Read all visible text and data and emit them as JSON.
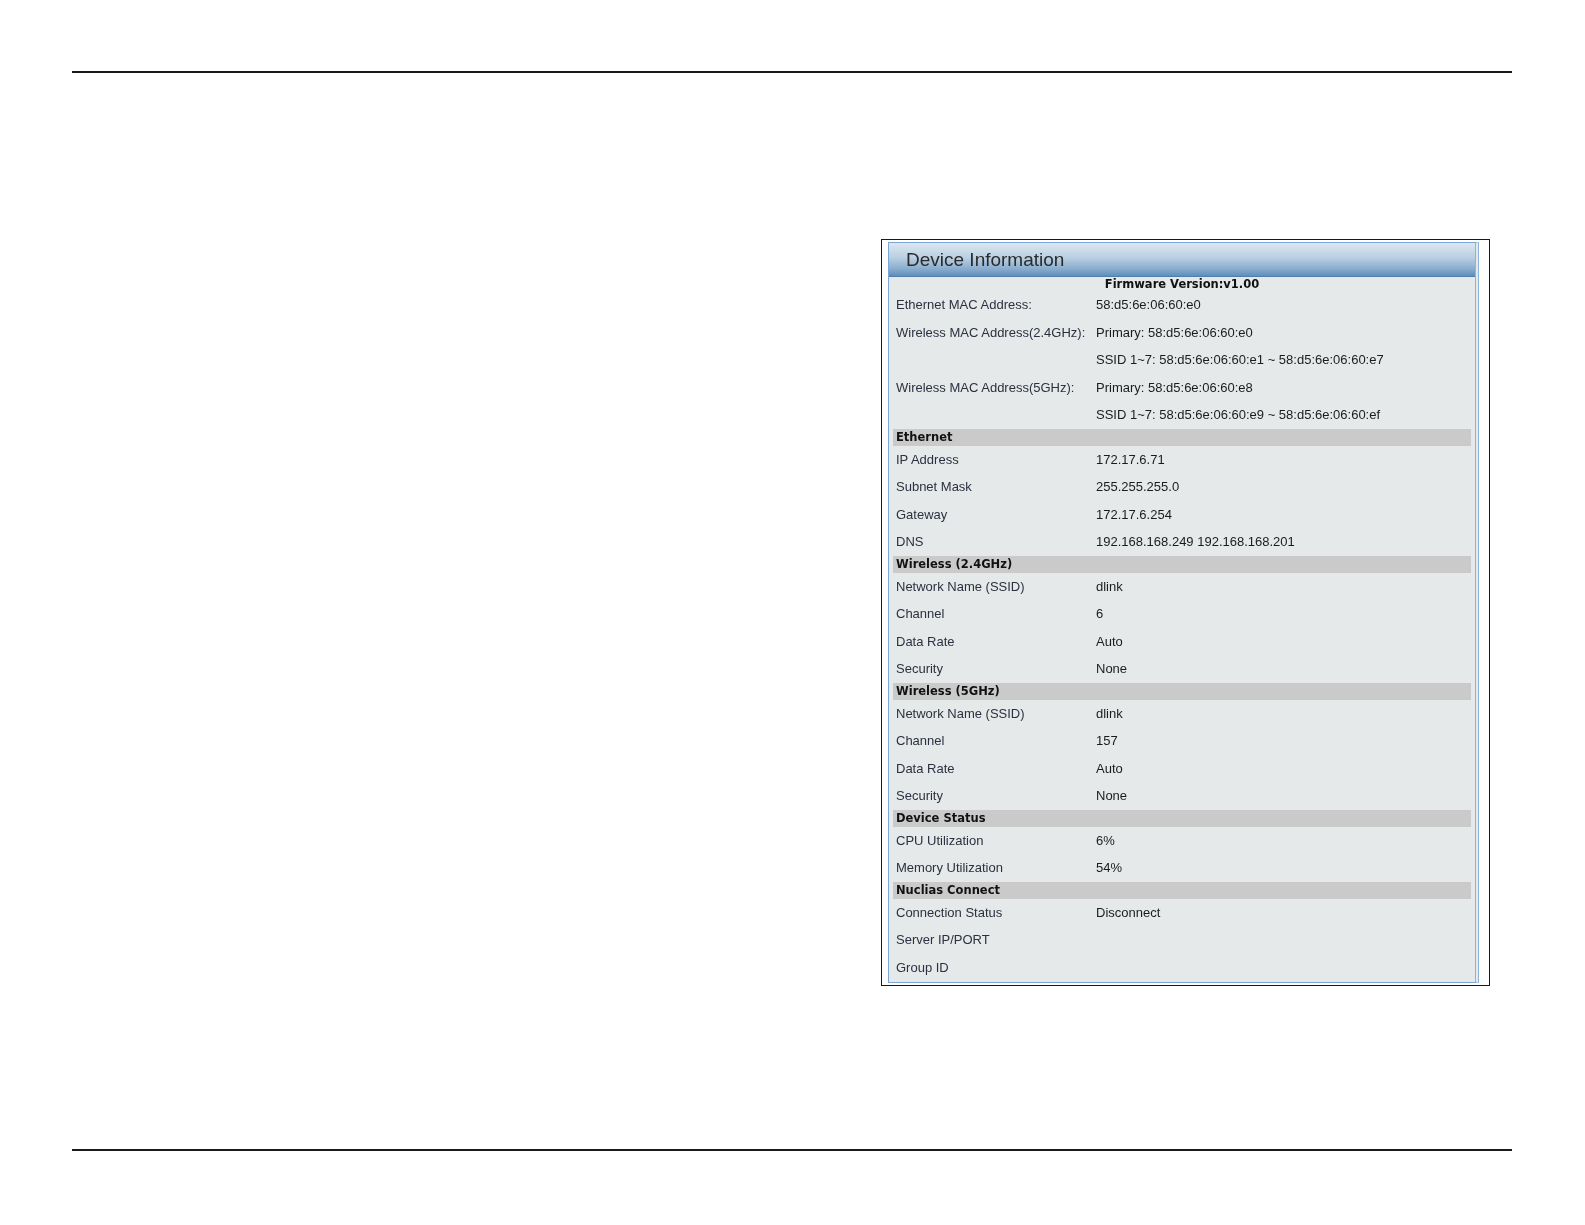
{
  "panel": {
    "title": "Device Information",
    "firmware": "Firmware Version:v1.00",
    "rows": [
      {
        "label": "Ethernet MAC Address:",
        "value": "58:d5:6e:06:60:e0"
      },
      {
        "label": "Wireless MAC Address(2.4GHz):",
        "value": "Primary: 58:d5:6e:06:60:e0"
      },
      {
        "value": "SSID 1~7: 58:d5:6e:06:60:e1 ~ 58:d5:6e:06:60:e7"
      },
      {
        "label": "Wireless MAC Address(5GHz):",
        "value": "Primary: 58:d5:6e:06:60:e8"
      },
      {
        "value": "SSID 1~7: 58:d5:6e:06:60:e9 ~ 58:d5:6e:06:60:ef"
      }
    ],
    "sections": [
      {
        "title": "Ethernet",
        "rows": [
          {
            "label": "IP Address",
            "value": "172.17.6.71"
          },
          {
            "label": "Subnet Mask",
            "value": "255.255.255.0"
          },
          {
            "label": "Gateway",
            "value": "172.17.6.254"
          },
          {
            "label": "DNS",
            "value": "192.168.168.249 192.168.168.201"
          }
        ]
      },
      {
        "title": "Wireless (2.4GHz)",
        "rows": [
          {
            "label": "Network Name (SSID)",
            "value": "dlink"
          },
          {
            "label": "Channel",
            "value": "6"
          },
          {
            "label": "Data Rate",
            "value": "Auto"
          },
          {
            "label": "Security",
            "value": "None"
          }
        ]
      },
      {
        "title": "Wireless (5GHz)",
        "rows": [
          {
            "label": "Network Name (SSID)",
            "value": "dlink"
          },
          {
            "label": "Channel",
            "value": "157"
          },
          {
            "label": "Data Rate",
            "value": "Auto"
          },
          {
            "label": "Security",
            "value": "None"
          }
        ]
      },
      {
        "title": "Device Status",
        "rows": [
          {
            "label": "CPU Utilization",
            "value": "6%"
          },
          {
            "label": "Memory Utilization",
            "value": "54%"
          }
        ]
      },
      {
        "title": "Nuclias Connect",
        "rows": [
          {
            "label": "Connection Status",
            "value": "Disconnect"
          },
          {
            "label": "Server IP/PORT"
          },
          {
            "label": "Group ID"
          }
        ]
      }
    ]
  }
}
